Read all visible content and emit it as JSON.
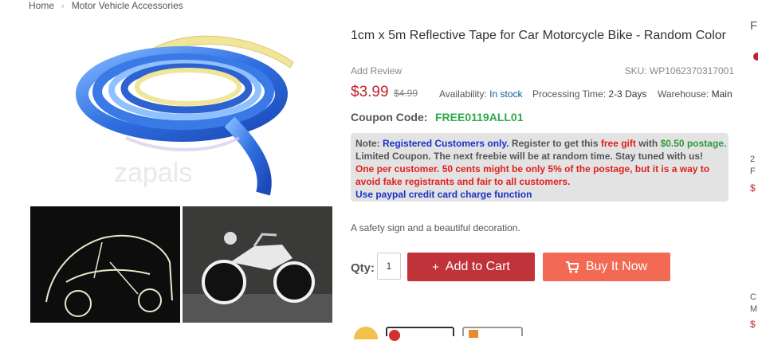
{
  "breadcrumb": {
    "home": "Home",
    "separator": "›",
    "category": "Motor Vehicle Accessories"
  },
  "product": {
    "title": "1cm x 5m Reflective Tape for Car Motorcycle Bike - Random Color",
    "add_review": "Add Review",
    "sku": "SKU: WP1062370317001",
    "price": "$3.99",
    "old_price": "$4.99",
    "availability_label": "Availability:",
    "availability_value": "In stock",
    "processing_label": "Processing Time:",
    "processing_value": "2-3 Days",
    "warehouse_label": "Warehouse:",
    "warehouse_value": "Main",
    "watermark": "zapals"
  },
  "coupon": {
    "label": "Coupon Code:",
    "code": "FREE0119ALL01"
  },
  "note": {
    "prefix": "Note:",
    "registered": "Registered Customers only.",
    "register_text": "Register to get this",
    "free_gift": "free gift",
    "with_text": "with",
    "postage": "$0.50 postage.",
    "limited": "Limited Coupon. The next freebie will be at random time. Stay tuned with us!",
    "red_line1": "One per customer. 50 cents might be only 5% of the postage, but it is a way to",
    "red_line2": "avoid fake registrants and fair to all customers.",
    "paypal": "Use paypal credit card charge function"
  },
  "description": "A safety sign and a beautiful decoration.",
  "purchase": {
    "qty_label": "Qty:",
    "qty_value": "1",
    "add_to_cart": "Add to Cart",
    "add_to_cart_glyph": "+",
    "buy_now": "Buy It Now"
  },
  "sidebar_partial": {
    "top": "F",
    "mid1": "2",
    "mid2": "F",
    "mid3": "$",
    "low1": "C",
    "low2": "M",
    "low3": "$"
  },
  "colors": {
    "price_red": "#c0232c",
    "cart_button": "#c0333a",
    "buy_button": "#f36a54",
    "coupon_green": "#2eaa4a",
    "note_bg": "#e3e3e3",
    "link_blue": "#0f5f96"
  }
}
